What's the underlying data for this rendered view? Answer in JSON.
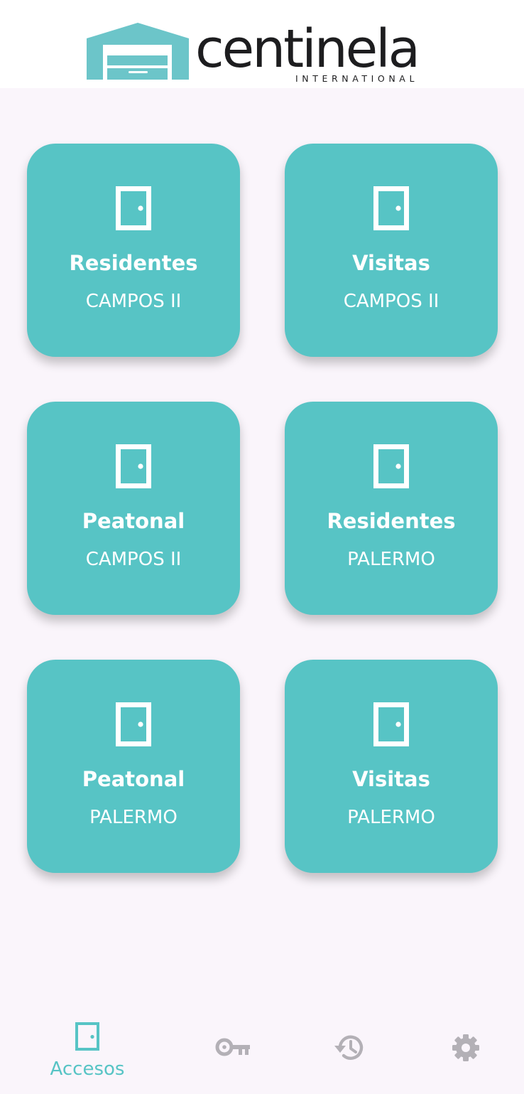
{
  "brand": {
    "name": "centinela",
    "subtitle": "INTERNATIONAL",
    "colors": {
      "accent": "#57c4c5",
      "logo_mark": "#6cc5c9",
      "text_dark": "#1d1d1f",
      "nav_inactive": "#b3b0b6",
      "background": "#faf5fb"
    }
  },
  "accesses": [
    {
      "name": "Residentes",
      "site": "CAMPOS II",
      "icon": "door-icon"
    },
    {
      "name": "Visitas",
      "site": "CAMPOS II",
      "icon": "door-icon"
    },
    {
      "name": "Peatonal",
      "site": "CAMPOS II",
      "icon": "door-icon"
    },
    {
      "name": "Residentes",
      "site": "PALERMO",
      "icon": "door-icon"
    },
    {
      "name": "Peatonal",
      "site": "PALERMO",
      "icon": "door-icon"
    },
    {
      "name": "Visitas",
      "site": "PALERMO",
      "icon": "door-icon"
    }
  ],
  "nav": {
    "items": [
      {
        "label": "Accesos",
        "icon": "door-icon",
        "active": true
      },
      {
        "label": "",
        "icon": "key-icon",
        "active": false
      },
      {
        "label": "",
        "icon": "history-icon",
        "active": false
      },
      {
        "label": "",
        "icon": "gear-icon",
        "active": false
      }
    ]
  }
}
